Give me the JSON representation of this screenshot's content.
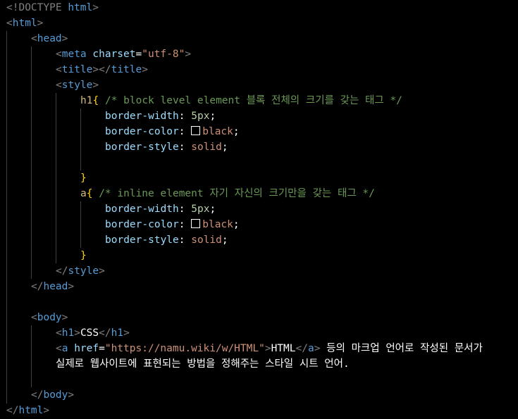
{
  "editor": {
    "language": "html",
    "colors": {
      "background": "#000000",
      "tag": "#569cd6",
      "punctuation": "#808080",
      "attribute": "#9cdcfe",
      "string": "#ce9178",
      "comment": "#6a9955",
      "selector": "#d7ba7d",
      "brace": "#ffd700",
      "number": "#b5cea8",
      "text": "#ffffff"
    }
  },
  "code": {
    "doctype": {
      "open": "<!DOCTYPE ",
      "name": "html",
      "close": ">"
    },
    "html_tag": "html",
    "head_tag": "head",
    "meta_tag": "meta",
    "charset_attr": "charset",
    "charset_value": "\"utf-8\"",
    "title_tag": "title",
    "style_tag": "style",
    "h1_selector": "h1",
    "h1_comment": "/* block level element 블록 전체의 크기를 갖는 태그 */",
    "a_selector": "a",
    "a_comment": "/* inline element 자기 자신의 크기만을 갖는 태그 */",
    "prop_border_width": "border-width",
    "prop_border_color": "border-color",
    "prop_border_style": "border-style",
    "value_width": "5px",
    "value_color": "black",
    "value_style": "solid",
    "colon": ":",
    "semicolon": ";",
    "brace_open": "{",
    "brace_close": "}",
    "body_tag": "body",
    "h1_tag": "h1",
    "h1_text": "CSS",
    "a_tag": "a",
    "href_attr": "href",
    "href_value": "\"https://namu.wiki/w/HTML\"",
    "a_text": "HTML",
    "paragraph_line1": " 등의 마크업 언어로 작성된 문서가",
    "paragraph_line2": "실제로 웹사이트에 표현되는 방법을 정해주는 스타일 시트 언어."
  }
}
